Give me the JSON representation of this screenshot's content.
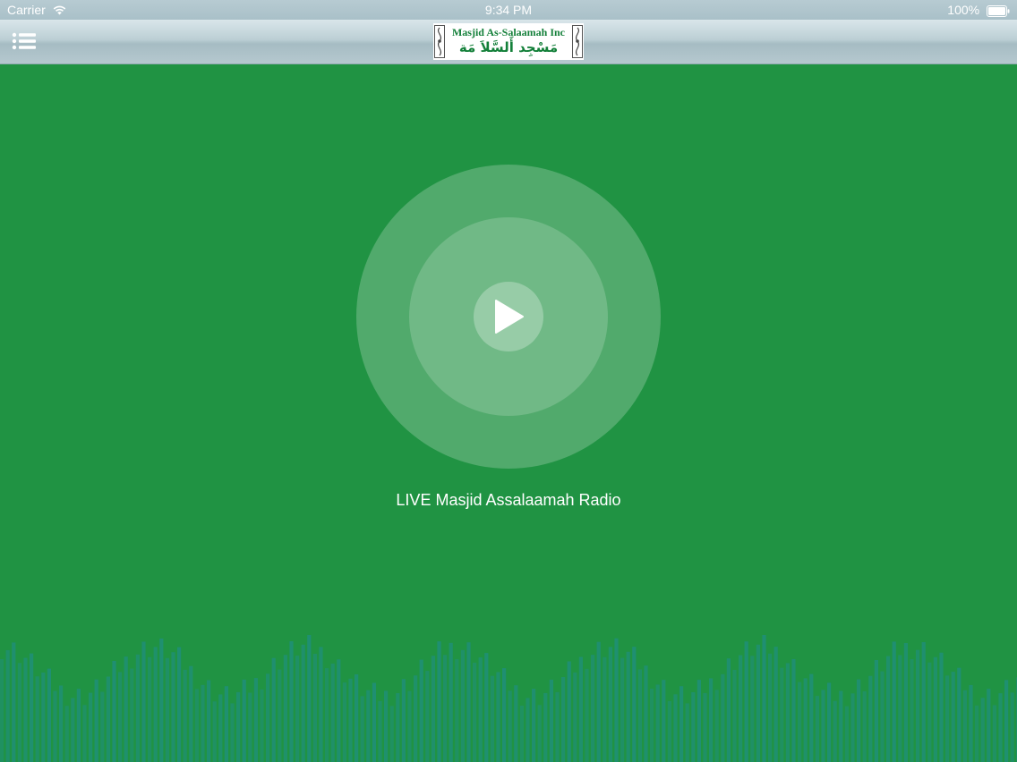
{
  "status_bar": {
    "carrier": "Carrier",
    "time": "9:34 PM",
    "battery": "100%"
  },
  "header": {
    "logo_en": "Masjid As-Salaamah Inc",
    "logo_ar": "مَسْجِد أَلسَّلاَ مَة"
  },
  "player": {
    "station_title": "LIVE Masjid Assalaamah Radio"
  },
  "icons": {
    "menu": "menu-list-icon",
    "play": "play-icon",
    "wifi": "wifi-icon",
    "battery": "battery-icon"
  },
  "colors": {
    "background": "#209343",
    "visualizer_bars": "#1f8f7a",
    "logo_text": "#14803a"
  }
}
